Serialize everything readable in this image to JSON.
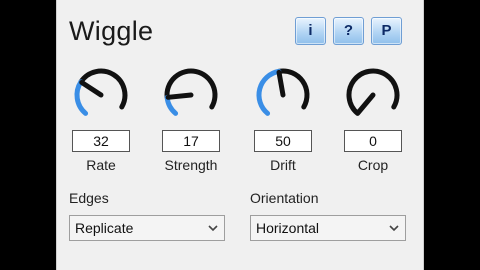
{
  "theme": {
    "accent": "#3a8ee6",
    "knob_dark": "#111111",
    "panel_bg": "#f0f0f0",
    "button_text": "#0d2a66"
  },
  "title": "Wiggle",
  "toolbar": {
    "info_label": "i",
    "help_label": "?",
    "preset_label": "P"
  },
  "knobs": [
    {
      "label": "Rate",
      "value": "32",
      "level": 0.32
    },
    {
      "label": "Strength",
      "value": "17",
      "level": 0.17
    },
    {
      "label": "Drift",
      "value": "50",
      "level": 0.5
    },
    {
      "label": "Crop",
      "value": "0",
      "level": 0.0
    }
  ],
  "edges": {
    "label": "Edges",
    "value": "Replicate"
  },
  "orientation": {
    "label": "Orientation",
    "value": "Horizontal"
  }
}
